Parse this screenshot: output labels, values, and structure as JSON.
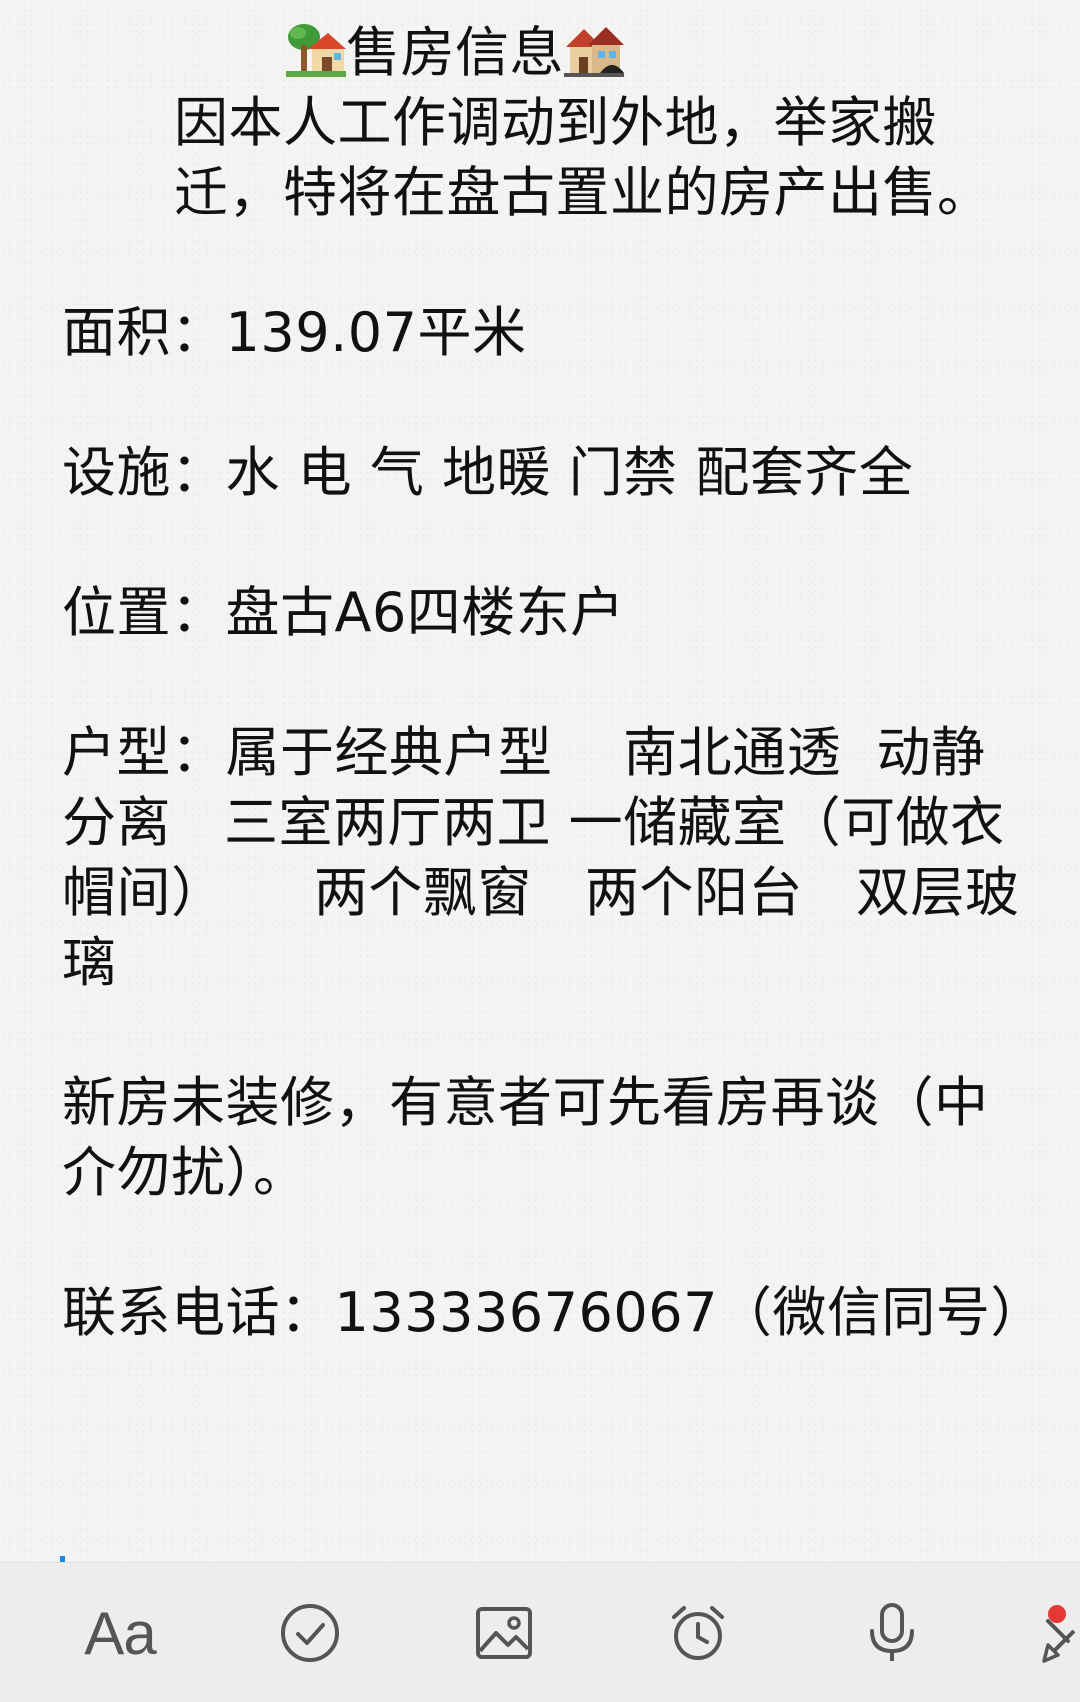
{
  "note": {
    "title": "售房信息",
    "title_emoji_left": "tree-house-emoji",
    "title_emoji_right": "houses-emoji",
    "intro": "因本人工作调动到外地，举家搬迁，特将在盘古置业的房产出售。",
    "area": "面积：139.07平米",
    "facilities": "设施：水 电 气 地暖 门禁 配套齐全",
    "location": "位置：盘古A6四楼东户",
    "layout": "户型：属于经典户型    南北通透  动静分离   三室两厅两卫 一储藏室（可做衣帽间）     两个飘窗   两个阳台   双层玻璃",
    "condition": "新房未装修，有意者可先看房再谈（中介勿扰）。",
    "contact": "联系电话：13333676067（微信同号）"
  },
  "toolbar": {
    "font_label": "Aa",
    "icons": [
      "font-icon",
      "checklist-icon",
      "image-icon",
      "alarm-icon",
      "microphone-icon",
      "brush-icon"
    ]
  },
  "colors": {
    "cursor": "#1e88e5",
    "icon": "#555555",
    "badge": "#e53935"
  }
}
